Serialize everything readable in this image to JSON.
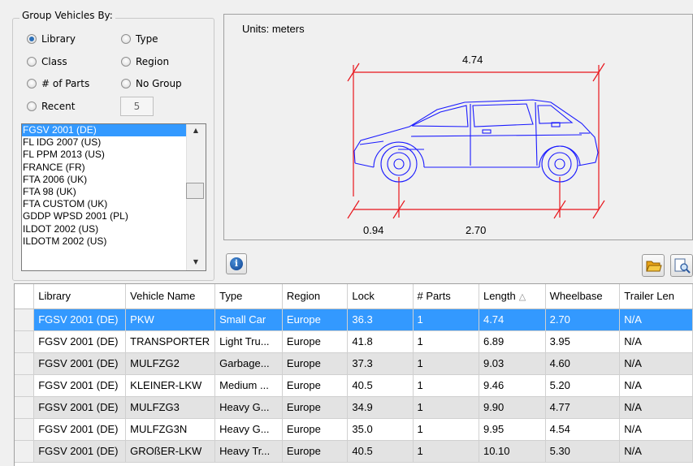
{
  "group": {
    "title": "Group Vehicles By:",
    "options": [
      {
        "label": "Library",
        "checked": true
      },
      {
        "label": "Type",
        "checked": false
      },
      {
        "label": "Class",
        "checked": false
      },
      {
        "label": "Region",
        "checked": false
      },
      {
        "label": "# of Parts",
        "checked": false
      },
      {
        "label": "No Group",
        "checked": false
      },
      {
        "label": "Recent",
        "checked": false
      }
    ],
    "recent_count": "5",
    "libraries": [
      "FGSV 2001 (DE)",
      "FL IDG 2007 (US)",
      "FL PPM 2013 (US)",
      "FRANCE (FR)",
      "FTA 2006 (UK)",
      "FTA 98 (UK)",
      "FTA CUSTOM (UK)",
      "GDDP WPSD 2001 (PL)",
      "ILDOT 2002 (US)",
      "ILDOTM 2002 (US)"
    ],
    "selected_library_index": 0
  },
  "drawing": {
    "units_label": "Units:  meters",
    "length_dim": "4.74",
    "front_overhang_dim": "0.94",
    "wheelbase_dim": "2.70",
    "dim_color": "#e8141b",
    "vehicle_color": "#1a1aff"
  },
  "buttons": {
    "info_icon": "info-icon",
    "open_icon": "folder-open-icon",
    "search_icon": "search-document-icon"
  },
  "table": {
    "columns": [
      "",
      "Library",
      "Vehicle Name",
      "Type",
      "Region",
      "Lock",
      "# Parts",
      "Length",
      "Wheelbase",
      "Trailer Len"
    ],
    "sort_column": "Length",
    "rows": [
      [
        "",
        "FGSV 2001 (DE)",
        "PKW",
        "Small Car",
        "Europe",
        "36.3",
        "1",
        "4.74",
        "2.70",
        "N/A"
      ],
      [
        "",
        "FGSV 2001 (DE)",
        "TRANSPORTER",
        "Light Tru...",
        "Europe",
        "41.8",
        "1",
        "6.89",
        "3.95",
        "N/A"
      ],
      [
        "",
        "FGSV 2001 (DE)",
        "MULFZG2",
        "Garbage...",
        "Europe",
        "37.3",
        "1",
        "9.03",
        "4.60",
        "N/A"
      ],
      [
        "",
        "FGSV 2001 (DE)",
        "KLEINER-LKW",
        "Medium ...",
        "Europe",
        "40.5",
        "1",
        "9.46",
        "5.20",
        "N/A"
      ],
      [
        "",
        "FGSV 2001 (DE)",
        "MULFZG3",
        "Heavy G...",
        "Europe",
        "34.9",
        "1",
        "9.90",
        "4.77",
        "N/A"
      ],
      [
        "",
        "FGSV 2001 (DE)",
        "MULFZG3N",
        "Heavy G...",
        "Europe",
        "35.0",
        "1",
        "9.95",
        "4.54",
        "N/A"
      ],
      [
        "",
        "FGSV 2001 (DE)",
        "GROßER-LKW",
        "Heavy Tr...",
        "Europe",
        "40.5",
        "1",
        "10.10",
        "5.30",
        "N/A"
      ]
    ],
    "selected_row": 0
  }
}
